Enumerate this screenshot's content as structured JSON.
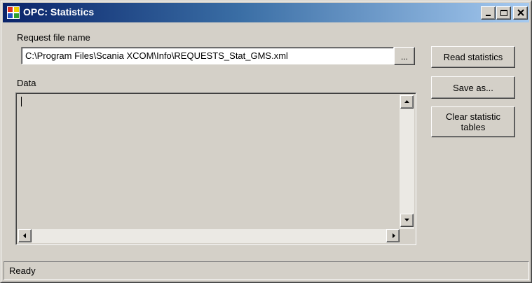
{
  "window": {
    "title": "OPC: Statistics",
    "icon": "opc-app-icon",
    "caption_buttons": {
      "minimize": "minimize-icon",
      "maximize": "maximize-icon",
      "close": "close-icon"
    }
  },
  "form": {
    "request_label": "Request file name",
    "request_value": "C:\\Program Files\\Scania XCOM\\Info\\REQUESTS_Stat_GMS.xml",
    "browse_label": "...",
    "data_label": "Data",
    "data_value": ""
  },
  "buttons": {
    "read": "Read statistics",
    "save": "Save as...",
    "clear": "Clear statistic tables"
  },
  "status": {
    "text": "Ready"
  },
  "colors": {
    "face": "#d4d0c8",
    "title_start": "#0a246a",
    "title_end": "#a6caf0"
  }
}
